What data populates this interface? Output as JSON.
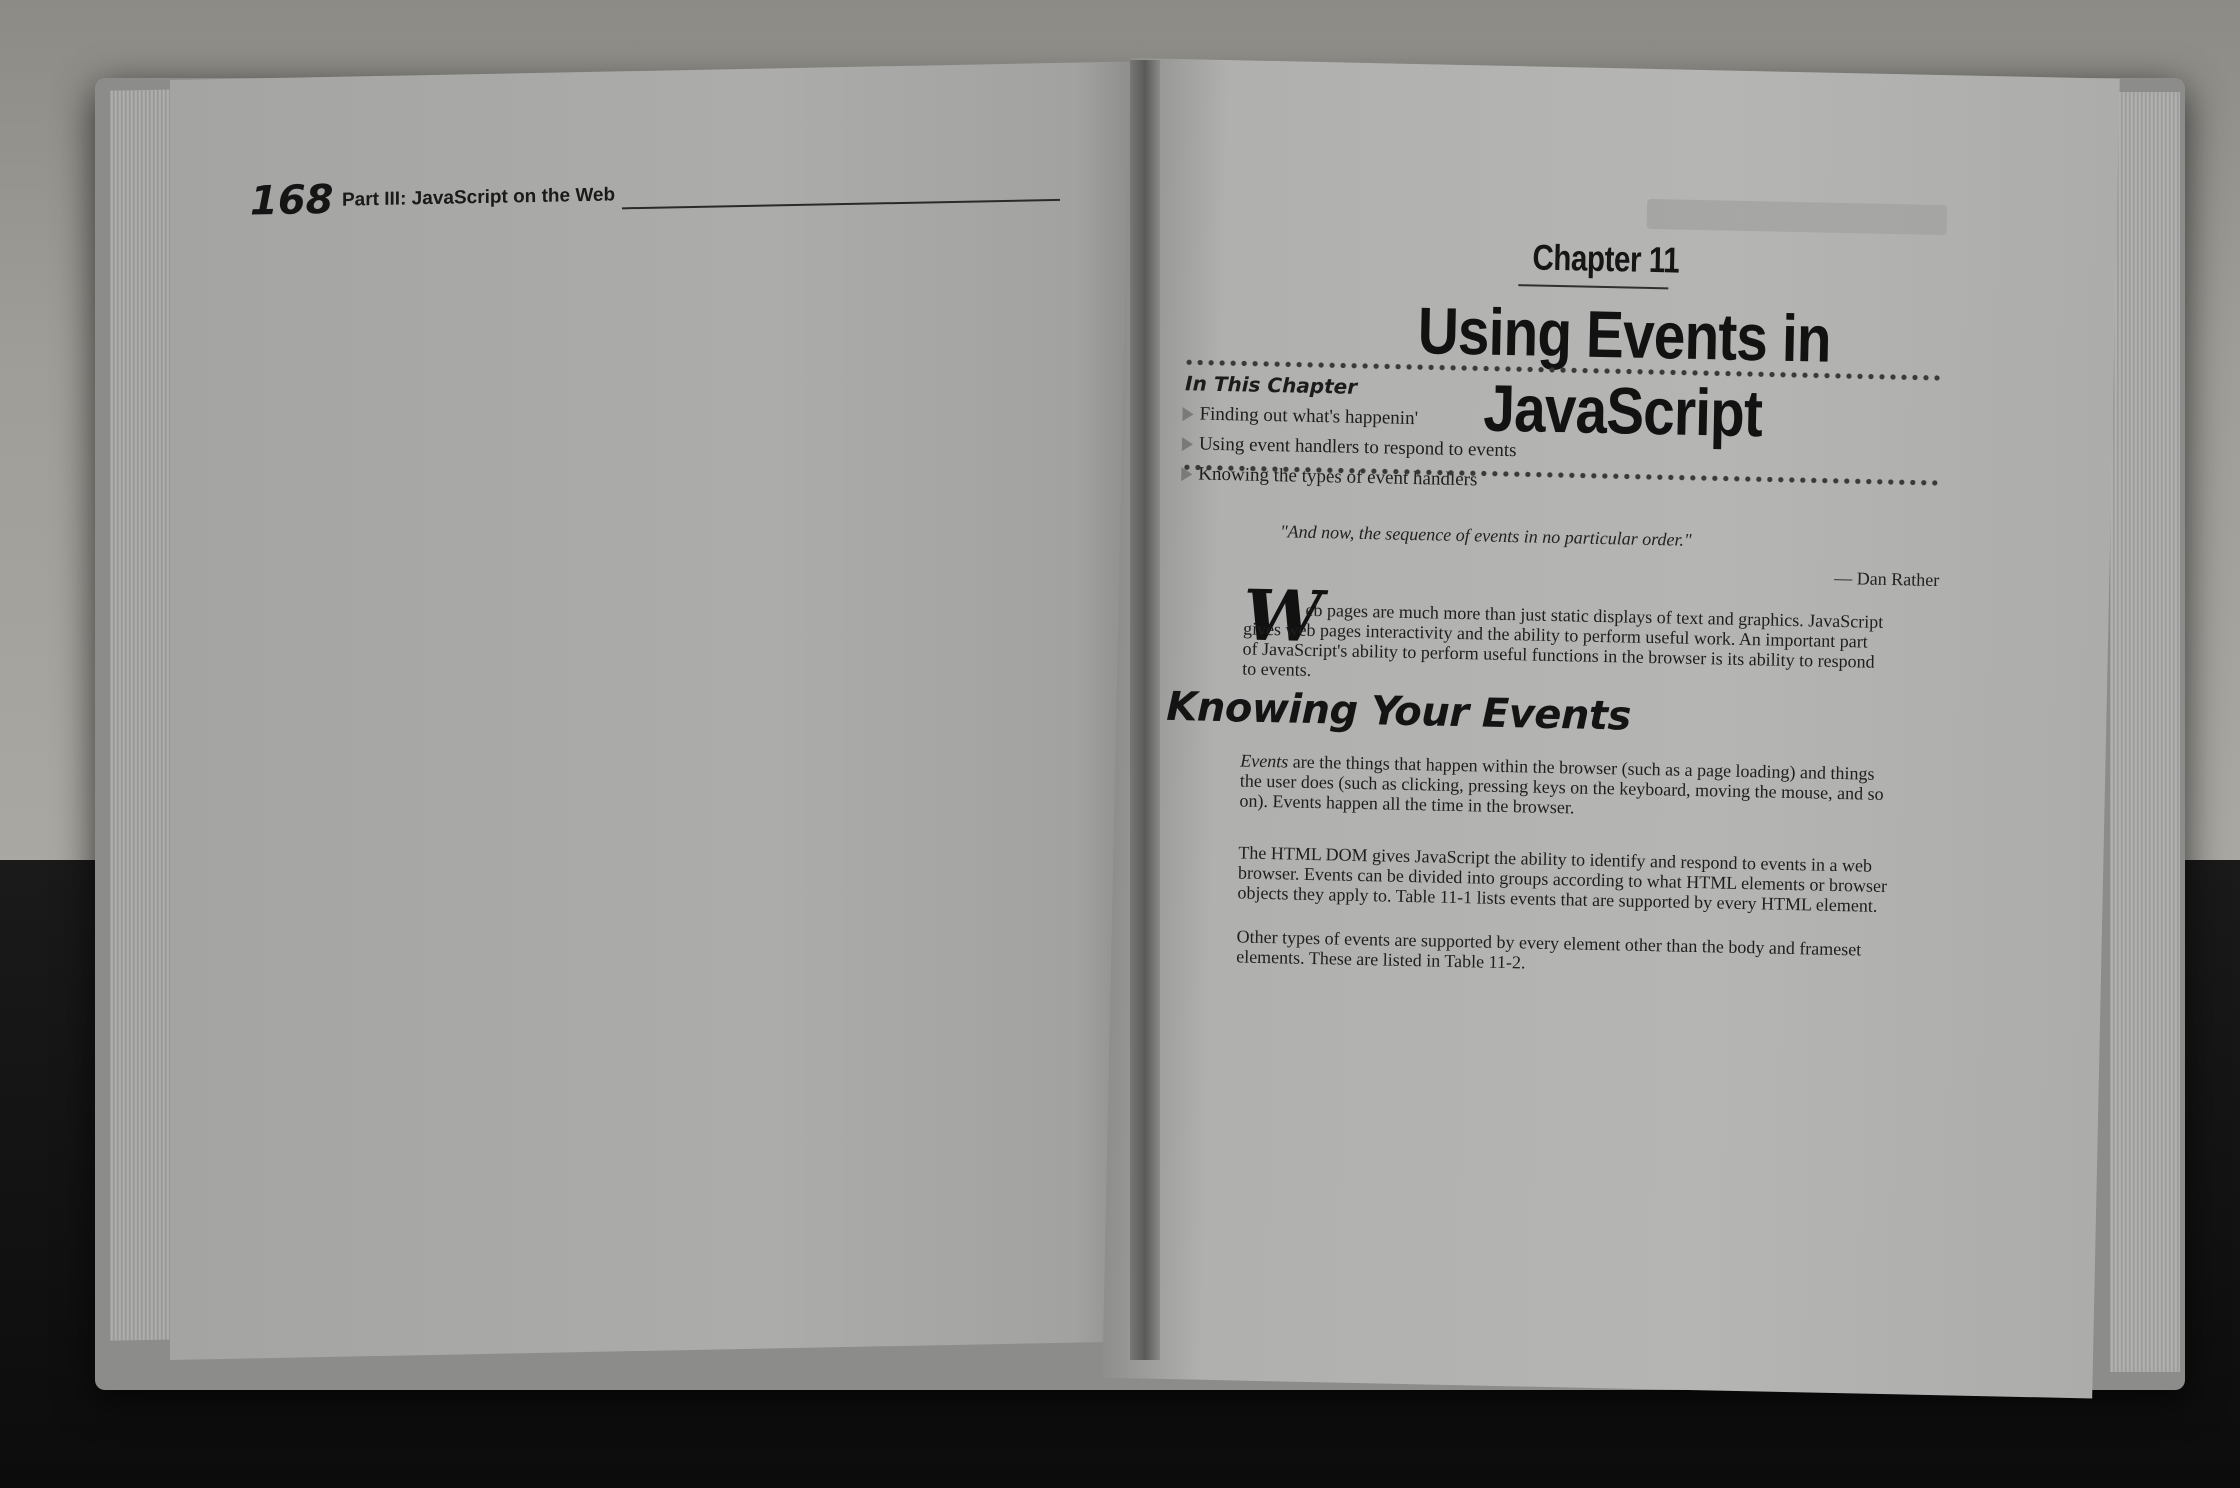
{
  "left_page": {
    "page_number": "168",
    "part_title": "Part III: JavaScript on the Web"
  },
  "right_page": {
    "chapter_label": "Chapter 11",
    "chapter_title": "Using Events in JavaScript",
    "in_this_chapter": {
      "heading": "In This Chapter",
      "items": [
        "Finding out what's happenin'",
        "Using event handlers to respond to events",
        "Knowing the types of event handlers"
      ]
    },
    "quote": "\"And now, the sequence of events in no particular order.\"",
    "attribution": "— Dan Rather",
    "intro": {
      "drop_cap": "W",
      "text": "eb pages are much more than just static displays of text and graphics. JavaScript gives web pages interactivity and the ability to perform useful work. An important part of JavaScript's ability to perform useful functions in the browser is its ability to respond to events."
    },
    "section_heading": "Knowing Your Events",
    "paragraphs": {
      "p1_lead": "Events",
      "p1_rest": " are the things that happen within the browser (such as a page loading) and things the user does (such as clicking, pressing keys on the keyboard, moving the mouse, and so on). Events happen all the time in the browser.",
      "p2": "The HTML DOM gives JavaScript the ability to identify and respond to events in a web browser. Events can be divided into groups according to what HTML elements or browser objects they apply to. Table 11-1 lists events that are supported by every HTML element.",
      "p3": "Other types of events are supported by every element other than the body and frameset elements. These are listed in Table 11-2."
    }
  }
}
